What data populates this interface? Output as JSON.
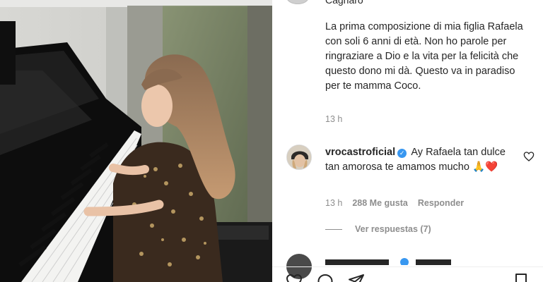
{
  "post": {
    "author_partial": "Cagnaro",
    "caption": "La prima composizione di mia figlia Rafaela con soli 6 anni di età. Non ho parole per ringraziare a Dio e la vita per la felicità che questo dono mi dà. Questo va in paradiso per te mamma Coco.",
    "caption_time": "13 h"
  },
  "comment": {
    "username": "vrocastroficial",
    "text": "Ay Rafaela tan dulce tan amorosa te amamos mucho",
    "emojis": "🙏❤️",
    "time": "13 h",
    "likes": "288 Me gusta",
    "reply_label": "Responder",
    "view_replies": "Ver respuestas (7)"
  },
  "icons": {
    "verified": "verified-badge-icon",
    "like": "heart-outline-icon",
    "comment": "comment-icon",
    "share": "share-icon",
    "save": "bookmark-icon"
  },
  "colors": {
    "text": "#262626",
    "muted": "#8e8e8e",
    "verified": "#3897f0",
    "heart": "#ed4956"
  }
}
